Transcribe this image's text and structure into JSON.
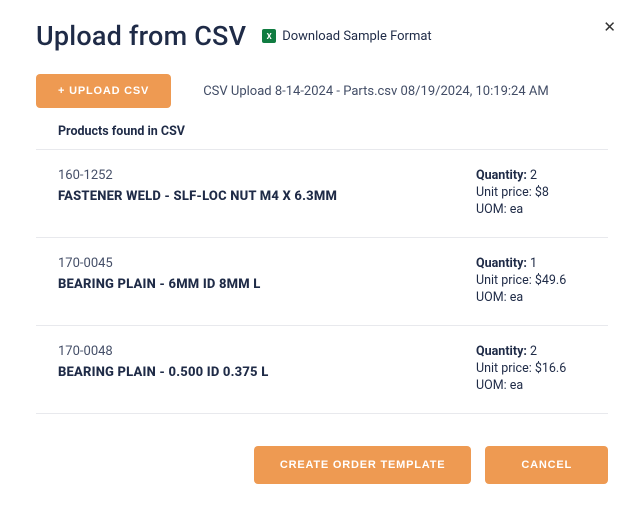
{
  "header": {
    "title": "Upload from CSV",
    "sample_link": "Download Sample Format",
    "excel_icon_glyph": "X"
  },
  "actions": {
    "upload_button": "+ UPLOAD CSV",
    "create_template": "CREATE ORDER TEMPLATE",
    "cancel": "CANCEL",
    "close_glyph": "✕"
  },
  "status": {
    "upload_line": "CSV Upload 8-14-2024 - Parts.csv 08/19/2024, 10:19:24 AM"
  },
  "labels": {
    "section": "Products found in CSV",
    "quantity": "Quantity:",
    "unit_price": "Unit price:",
    "uom": "UOM:"
  },
  "products": [
    {
      "sku": "160-1252",
      "name": "FASTENER WELD - SLF-LOC NUT M4 X 6.3MM",
      "quantity": "2",
      "unit_price": "$8",
      "uom": "ea"
    },
    {
      "sku": "170-0045",
      "name": "BEARING PLAIN - 6MM ID 8MM L",
      "quantity": "1",
      "unit_price": "$49.6",
      "uom": "ea"
    },
    {
      "sku": "170-0048",
      "name": "BEARING PLAIN - 0.500 ID 0.375 L",
      "quantity": "2",
      "unit_price": "$16.6",
      "uom": "ea"
    }
  ]
}
